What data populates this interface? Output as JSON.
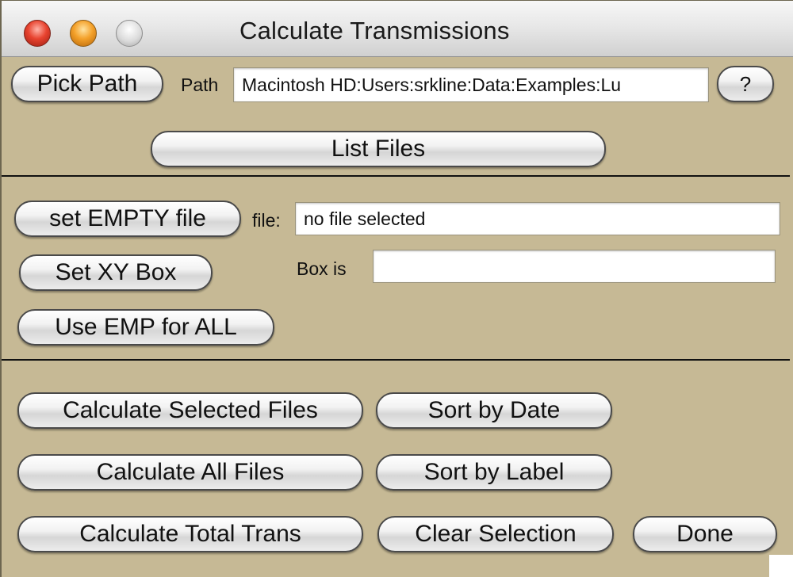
{
  "window": {
    "title": "Calculate Transmissions"
  },
  "path_row": {
    "pick_path_label": "Pick Path",
    "path_label": "Path",
    "path_value": "Macintosh HD:Users:srkline:Data:Examples:Lu",
    "help_label": "?"
  },
  "list_files_label": "List Files",
  "empty_section": {
    "set_empty_label": "set EMPTY file",
    "file_label": "file:",
    "file_value": "no file selected",
    "set_xy_label": "Set XY Box",
    "box_label": "Box is",
    "box_value": "",
    "use_emp_label": "Use EMP for ALL"
  },
  "actions": {
    "calc_selected_label": "Calculate Selected Files",
    "sort_date_label": "Sort by Date",
    "calc_all_label": "Calculate All Files",
    "sort_label_label": "Sort by Label",
    "calc_total_label": "Calculate Total Trans",
    "clear_selection_label": "Clear Selection",
    "done_label": "Done"
  },
  "colors": {
    "panel_background": "#c6b995",
    "close_button": "#e8432f",
    "minimize_button": "#f4a12a",
    "zoom_button": "#dcdcdc"
  }
}
